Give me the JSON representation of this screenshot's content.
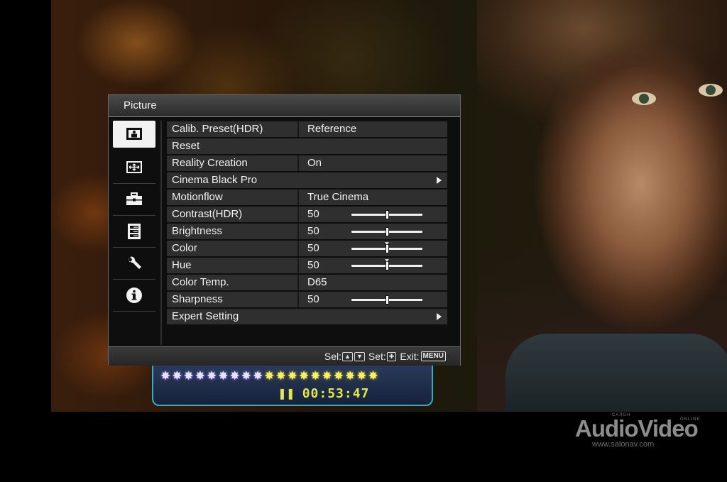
{
  "menu": {
    "title": "Picture",
    "footer": {
      "sel_label": "Sel:",
      "set_label": "Set:",
      "exit_label": "Exit:",
      "menu_key": "MENU"
    },
    "sidebar": [
      {
        "icon": "picture-icon",
        "active": true
      },
      {
        "icon": "screen-icon"
      },
      {
        "icon": "toolbox-icon"
      },
      {
        "icon": "list-settings-icon"
      },
      {
        "icon": "wrench-icon"
      },
      {
        "icon": "info-icon"
      }
    ],
    "rows": [
      {
        "label": "Calib. Preset(HDR)",
        "value": "Reference"
      },
      {
        "label": "Reset"
      },
      {
        "label": "Reality Creation",
        "value": "On"
      },
      {
        "label": "Cinema Black Pro",
        "submenu": true
      },
      {
        "label": "Motionflow",
        "value": "True Cinema"
      },
      {
        "label": "Contrast(HDR)",
        "value": "50",
        "slider": 50
      },
      {
        "label": "Brightness",
        "value": "50",
        "slider": 50
      },
      {
        "label": "Color",
        "value": "50",
        "slider": 50,
        "center_mark": true
      },
      {
        "label": "Hue",
        "value": "50",
        "slider": 50,
        "center_mark": true
      },
      {
        "label": "Color Temp.",
        "value": "D65"
      },
      {
        "label": "Sharpness",
        "value": "50",
        "slider": 50
      },
      {
        "label": "Expert Setting",
        "submenu": true
      }
    ]
  },
  "hud": {
    "time": "00:53:47",
    "pause_glyph": "❚❚",
    "stars_purple": 9,
    "stars_yellow": 10
  },
  "watermark": {
    "brand": "AudioVideo",
    "small_left": "САЛОН",
    "small_right": "ONLINE",
    "url": "www.salonav.com"
  }
}
